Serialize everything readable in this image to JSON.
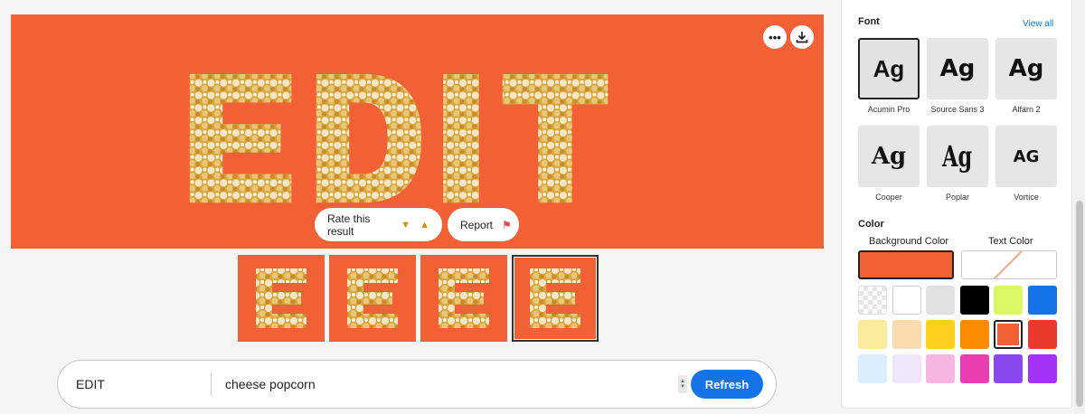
{
  "preview": {
    "text": "EDIT",
    "more_label": "•••",
    "rate_label": "Rate this result",
    "report_label": "Report"
  },
  "prompt": {
    "text": "EDIT",
    "style": "cheese popcorn",
    "refresh_label": "Refresh"
  },
  "panel": {
    "font_label": "Font",
    "view_all": "View all",
    "fonts": [
      {
        "sample": "Ag",
        "name": "Acumin Pro"
      },
      {
        "sample": "Ag",
        "name": "Source Sans 3"
      },
      {
        "sample": "Ag",
        "name": "Alfarn 2"
      },
      {
        "sample": "Ag",
        "name": "Cooper"
      },
      {
        "sample": "Ag",
        "name": "Poplar"
      },
      {
        "sample": "AG",
        "name": "Vortice"
      }
    ],
    "color_label": "Color",
    "background_color_label": "Background Color",
    "text_color_label": "Text Color",
    "background_color": "#f26136",
    "swatches": [
      [
        "transparent",
        "#ffffff",
        "#e1e1e1",
        "#000000",
        "#dcf764",
        "#1473e6"
      ],
      [
        "#f9ec9a",
        "#fbdcb1",
        "#ffcf1f",
        "#ff8c00",
        "#f26136",
        "#e93a2c"
      ],
      [
        "#dcedfb",
        "#f0e6fb",
        "#f5b7e0",
        "#e83eb0",
        "#8b48f0",
        "#a432f7"
      ]
    ]
  },
  "colors": {
    "accent": "#1473e6",
    "preview_bg": "#f26136"
  }
}
